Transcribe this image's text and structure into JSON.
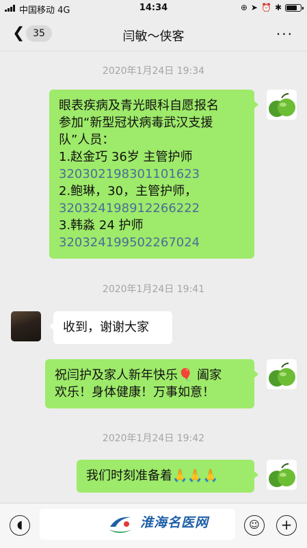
{
  "status_bar": {
    "carrier": "中国移动",
    "network": "4G",
    "time": "14:34",
    "icons": [
      "lock-rotation-icon",
      "location-icon",
      "alarm-icon",
      "bluetooth-icon",
      "battery-icon"
    ]
  },
  "nav": {
    "unread_count": "35",
    "title": "闫敏～侠客",
    "more_label": "···"
  },
  "messages": [
    {
      "type": "timestamp",
      "text": "2020年1月24日 19:34"
    },
    {
      "type": "sent",
      "lines": [
        "眼表疾病及青光眼科自愿报名",
        "参加“新型冠状病毒武汉支援",
        "队”人员：",
        "1.赵金巧 36岁 主管护师",
        "320302198301101623",
        "2.鲍琳，30，主管护师，",
        "320324198912266222",
        "3.韩淼 24  护师",
        "320324199502267024"
      ]
    },
    {
      "type": "timestamp",
      "text": "2020年1月24日 19:41"
    },
    {
      "type": "received",
      "text": "收到，谢谢大家"
    },
    {
      "type": "sent",
      "lines": [
        "祝闫护及家人新年快乐🎈 阖家",
        "欢乐！身体健康！万事如意！"
      ]
    },
    {
      "type": "timestamp",
      "text": "2020年1月24日 19:42"
    },
    {
      "type": "sent",
      "text": "我们时刻准备着🙏🙏🙏"
    }
  ],
  "input_bar": {
    "voice_icon": "voice-icon",
    "emoji_icon": "emoji-icon",
    "plus_icon": "plus-icon",
    "watermark": "淮海名医网"
  },
  "colors": {
    "sent_bubble": "#9eea6a",
    "received_bubble": "#ffffff",
    "link": "#4b6d99",
    "background": "#ededed"
  }
}
